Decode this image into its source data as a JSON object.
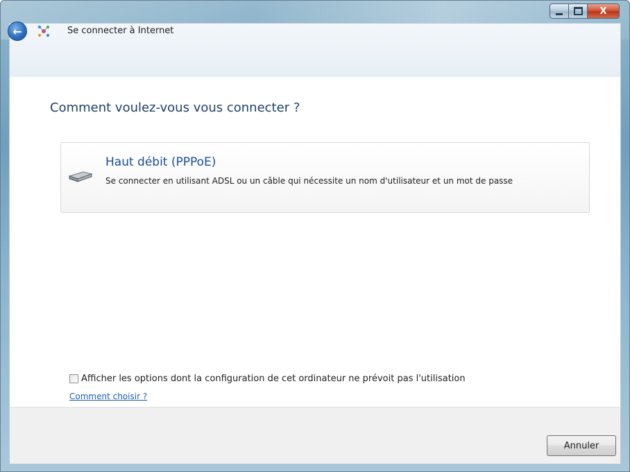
{
  "window": {
    "title": "Se connecter à Internet",
    "buttons": {
      "minimize_icon": "minimize-icon",
      "maximize_icon": "maximize-icon",
      "close_icon": "close-icon",
      "close_glyph": "X"
    }
  },
  "nav": {
    "back_icon": "back-arrow-icon",
    "back_glyph": "←",
    "wizard_icon": "network-connection-icon"
  },
  "main": {
    "heading": "Comment voulez-vous vous connecter ?",
    "options": [
      {
        "icon": "broadband-modem-icon",
        "title": "Haut débit (PPPoE)",
        "description": "Se connecter en utilisant ADSL ou un câble qui nécessite un nom d'utilisateur et un mot de passe"
      }
    ],
    "show_options_checkbox": {
      "label": "Afficher les options dont la configuration de cet ordinateur ne prévoit pas l'utilisation",
      "checked": false
    },
    "help_link": "Comment choisir ?"
  },
  "footer": {
    "cancel_label": "Annuler"
  },
  "colors": {
    "accent": "#1a4f96",
    "heading": "#1e3f6b",
    "link": "#1a5db8",
    "close_button": "#c8452a",
    "frame": "#8cb5cf"
  }
}
